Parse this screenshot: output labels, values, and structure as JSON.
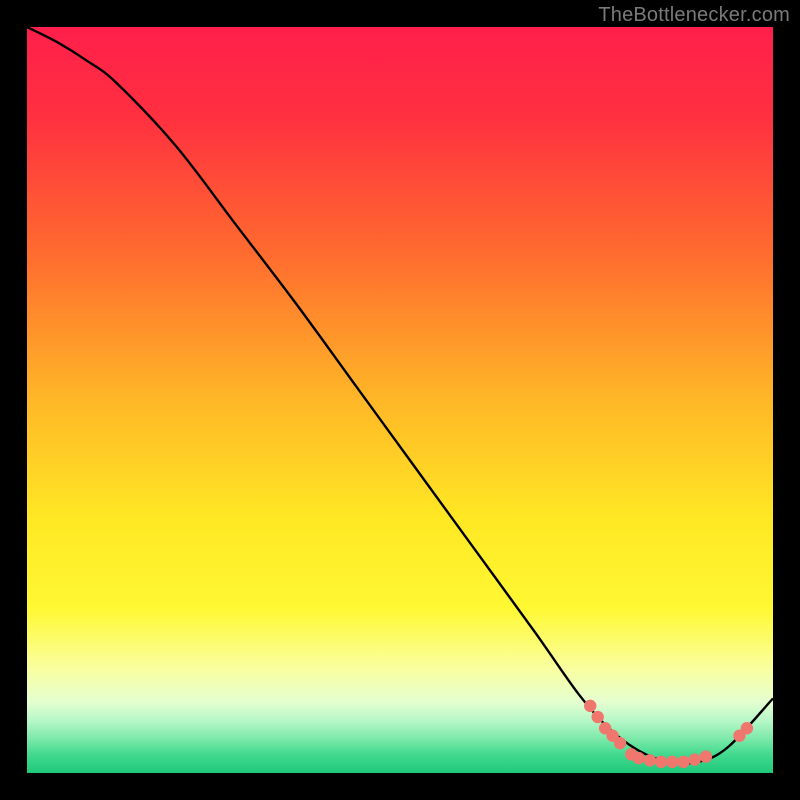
{
  "attribution": "TheBottlenecker.com",
  "chart_data": {
    "type": "line",
    "title": "",
    "xlabel": "",
    "ylabel": "",
    "xlim": [
      0,
      100
    ],
    "ylim": [
      0,
      100
    ],
    "grid": false,
    "series": [
      {
        "name": "curve",
        "x": [
          0,
          4,
          8,
          12,
          20,
          28,
          36,
          44,
          52,
          60,
          68,
          74,
          78,
          82,
          86,
          90,
          94,
          100
        ],
        "y": [
          100,
          98,
          95.5,
          92.5,
          84,
          73.5,
          63,
          52,
          41,
          30,
          19,
          10.5,
          6,
          3,
          1.5,
          1.5,
          3.5,
          10
        ]
      }
    ],
    "markers": {
      "name": "highlight-points",
      "color": "#f0776d",
      "points": [
        {
          "x": 75.5,
          "y": 9.0
        },
        {
          "x": 76.5,
          "y": 7.5
        },
        {
          "x": 77.5,
          "y": 6.0
        },
        {
          "x": 78.5,
          "y": 5.0
        },
        {
          "x": 79.5,
          "y": 4.0
        },
        {
          "x": 81.0,
          "y": 2.5
        },
        {
          "x": 82.0,
          "y": 2.0
        },
        {
          "x": 83.5,
          "y": 1.7
        },
        {
          "x": 85.0,
          "y": 1.5
        },
        {
          "x": 86.5,
          "y": 1.5
        },
        {
          "x": 88.0,
          "y": 1.5
        },
        {
          "x": 89.5,
          "y": 1.8
        },
        {
          "x": 91.0,
          "y": 2.2
        },
        {
          "x": 95.5,
          "y": 5.0
        },
        {
          "x": 96.5,
          "y": 6.0
        }
      ]
    },
    "gradient_stops": [
      {
        "offset": 0.0,
        "color": "#ff1f4b"
      },
      {
        "offset": 0.12,
        "color": "#ff3040"
      },
      {
        "offset": 0.3,
        "color": "#ff6a2f"
      },
      {
        "offset": 0.5,
        "color": "#ffb727"
      },
      {
        "offset": 0.66,
        "color": "#ffe824"
      },
      {
        "offset": 0.78,
        "color": "#fff833"
      },
      {
        "offset": 0.86,
        "color": "#faffa0"
      },
      {
        "offset": 0.905,
        "color": "#e4ffd0"
      },
      {
        "offset": 0.93,
        "color": "#b6f7c8"
      },
      {
        "offset": 0.955,
        "color": "#7ae8a8"
      },
      {
        "offset": 0.975,
        "color": "#42d98f"
      },
      {
        "offset": 1.0,
        "color": "#1fc97a"
      }
    ]
  }
}
